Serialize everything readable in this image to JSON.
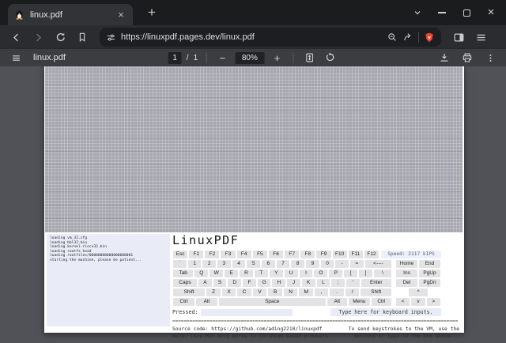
{
  "window": {
    "tab_title": "linux.pdf",
    "url": "https://linuxpdf.pages.dev/linux.pdf"
  },
  "pdf_toolbar": {
    "title": "linux.pdf",
    "page_current": "1",
    "page_divider": "/",
    "page_total": "1",
    "zoom_out_label": "−",
    "zoom_level": "80%",
    "zoom_in_label": "+"
  },
  "vm": {
    "console_lines": [
      "loading vm_32.cfg",
      "loading bbl32.bin",
      "loading kernel-riscv32.bin",
      "loading rootfs.head",
      "loading rootfiles/00000000000000000001",
      "starting the machine, please be patient..."
    ],
    "title": "LinuxPDF",
    "speed": "Speed: 2117 kIPS",
    "keyboard_rows": [
      {
        "speed": true,
        "keys": [
          [
            "Esc",
            1
          ],
          [
            "F1",
            1
          ],
          [
            "F2",
            1
          ],
          [
            "F3",
            1
          ],
          [
            "F4",
            1
          ],
          [
            "F5",
            1
          ],
          [
            "F6",
            1
          ],
          [
            "F7",
            1
          ],
          [
            "F8",
            1
          ],
          [
            "F9",
            1
          ],
          [
            "F10",
            1
          ],
          [
            "F11",
            1
          ],
          [
            "F12",
            1
          ]
        ]
      },
      {
        "nav": [
          [
            "Home",
            1
          ],
          [
            "End",
            1
          ]
        ],
        "keys": [
          [
            "`",
            1
          ],
          [
            "1",
            1
          ],
          [
            "2",
            1
          ],
          [
            "3",
            1
          ],
          [
            "4",
            1
          ],
          [
            "5",
            1
          ],
          [
            "6",
            1
          ],
          [
            "7",
            1
          ],
          [
            "8",
            1
          ],
          [
            "9",
            1
          ],
          [
            "0",
            1
          ],
          [
            "-",
            1
          ],
          [
            "=",
            1
          ],
          [
            "<----",
            2
          ]
        ]
      },
      {
        "nav": [
          [
            "Ins",
            1
          ],
          [
            "PgUp",
            1
          ]
        ],
        "keys": [
          [
            "Tab",
            1.5
          ],
          [
            "Q",
            1
          ],
          [
            "W",
            1
          ],
          [
            "E",
            1
          ],
          [
            "R",
            1
          ],
          [
            "T",
            1
          ],
          [
            "Y",
            1
          ],
          [
            "U",
            1
          ],
          [
            "I",
            1
          ],
          [
            "O",
            1
          ],
          [
            "P",
            1
          ],
          [
            "[",
            1
          ],
          [
            "]",
            1
          ],
          [
            "\\",
            1.3
          ]
        ]
      },
      {
        "nav": [
          [
            "Del",
            1
          ],
          [
            "PgDn",
            1
          ]
        ],
        "keys": [
          [
            "Caps",
            1.8
          ],
          [
            "A",
            1
          ],
          [
            "S",
            1
          ],
          [
            "D",
            1
          ],
          [
            "F",
            1
          ],
          [
            "G",
            1
          ],
          [
            "H",
            1
          ],
          [
            "J",
            1
          ],
          [
            "K",
            1
          ],
          [
            "L",
            1
          ],
          [
            ";",
            1
          ],
          [
            "'",
            1
          ],
          [
            "Enter",
            2.3
          ]
        ]
      },
      {
        "nav": [
          [
            "",
            0.6
          ],
          [
            "^",
            1
          ],
          [
            "",
            0.6
          ]
        ],
        "keys": [
          [
            "Shift",
            2.3
          ],
          [
            "Z",
            1
          ],
          [
            "X",
            1
          ],
          [
            "C",
            1
          ],
          [
            "V",
            1
          ],
          [
            "B",
            1
          ],
          [
            "N",
            1
          ],
          [
            "M",
            1
          ],
          [
            ",",
            1
          ],
          [
            ".",
            1
          ],
          [
            "/",
            1
          ],
          [
            "Shift",
            2.2
          ]
        ]
      },
      {
        "nav": [
          [
            "<",
            1
          ],
          [
            "v",
            1
          ],
          [
            ">",
            1
          ]
        ],
        "keys": [
          [
            "Ctrl",
            1.5
          ],
          [
            "Alt",
            1.5
          ],
          [
            "Space",
            7.5
          ],
          [
            "Alt",
            1.4
          ],
          [
            "Menu",
            1.5
          ],
          [
            "Ctrl",
            1.4
          ]
        ]
      }
    ],
    "pressed_label": "Pressed:",
    "type_hint": "Type here for keyboard inputs.",
    "separator": "====================================================================================================",
    "footer_left_1": "Source code: https://github.com/ading2210/linuxpdf",
    "footer_left_2": "Note: This PDF only works in Chromium-based browsers.",
    "footer_right_1": "To send keystrokes to the VM, use the",
    "footer_right_2": "buttons or type in the box above."
  }
}
